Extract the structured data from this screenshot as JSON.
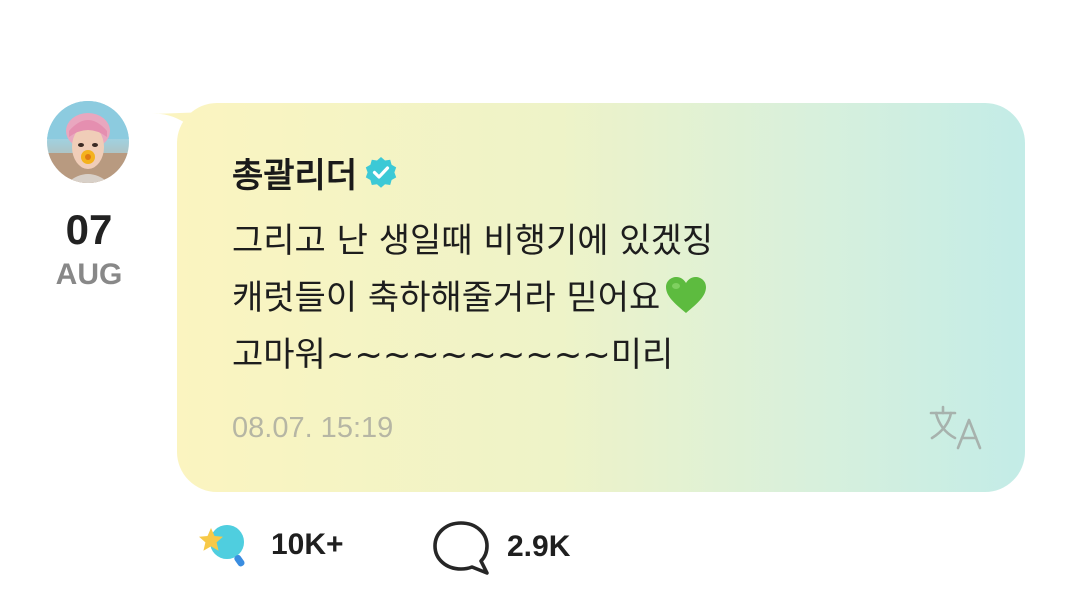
{
  "post": {
    "author_name": "총괄리더",
    "verified": true,
    "message_lines": [
      "그리고 난 생일때 비행기에 있겠징",
      "캐럿들이 축하해줄거라 믿어요",
      "고마워~~~~~~~~~~미리"
    ],
    "line2_emoji": "green-heart",
    "timestamp": "08.07. 15:19"
  },
  "date": {
    "day": "07",
    "month": "AUG"
  },
  "footer": {
    "reaction_count": "10K+",
    "comment_count": "2.9K"
  },
  "colors": {
    "verified": "#3cc9d6",
    "heart": "#5dbb3f",
    "bubble_start": "#fbf4c0",
    "bubble_end": "#c3ece7"
  },
  "icons": [
    "verified-badge-icon",
    "green-heart-icon",
    "translate-icon",
    "reaction-star-icon",
    "comment-bubble-icon"
  ]
}
